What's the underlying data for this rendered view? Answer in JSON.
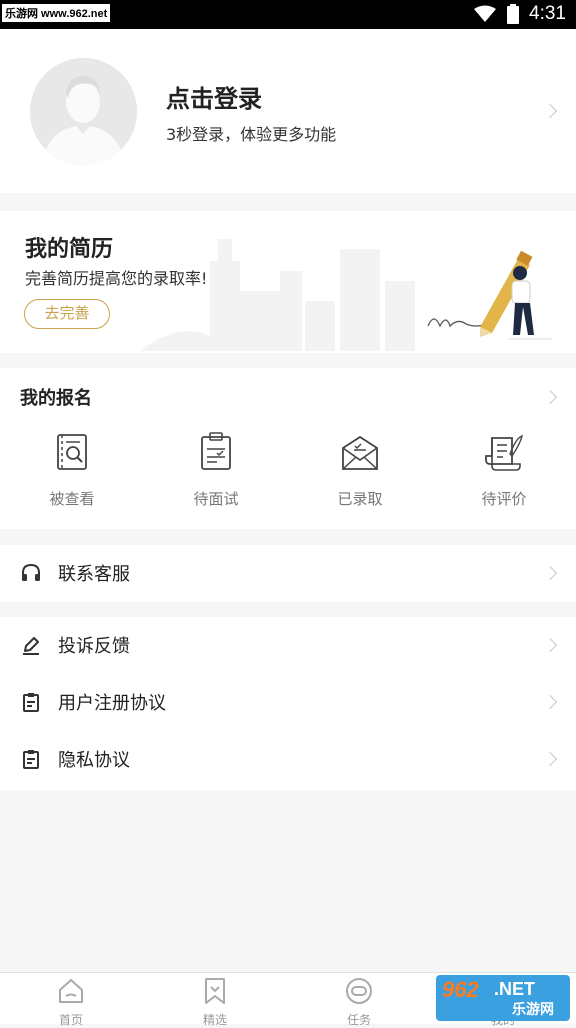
{
  "status_bar": {
    "watermark": "乐游网 www.962.net",
    "time": "4:31"
  },
  "login": {
    "title": "点击登录",
    "subtitle": "3秒登录，体验更多功能"
  },
  "resume": {
    "title": "我的简历",
    "subtitle": "完善简历提高您的录取率!",
    "button": "去完善"
  },
  "signup": {
    "title": "我的报名",
    "items": [
      {
        "label": "被查看",
        "icon": "viewed-icon"
      },
      {
        "label": "待面试",
        "icon": "clipboard-interview-icon"
      },
      {
        "label": "已录取",
        "icon": "envelope-accepted-icon"
      },
      {
        "label": "待评价",
        "icon": "scroll-review-icon"
      }
    ]
  },
  "service": {
    "label": "联系客服",
    "icon": "headset-icon"
  },
  "menu": [
    {
      "label": "投诉反馈",
      "icon": "edit-icon"
    },
    {
      "label": "用户注册协议",
      "icon": "document-icon"
    },
    {
      "label": "隐私协议",
      "icon": "document-icon"
    }
  ],
  "tabbar": [
    {
      "label": "首页",
      "icon": "home-icon"
    },
    {
      "label": "精选",
      "icon": "bookmark-icon"
    },
    {
      "label": "任务",
      "icon": "task-icon"
    },
    {
      "label": "我的",
      "icon": "profile-icon"
    }
  ],
  "bottom_watermark": {
    "brand": "962",
    "net": ".NET",
    "cn": "乐游网"
  },
  "colors": {
    "accent": "#c9a24c",
    "text": "#222222",
    "muted": "#777777",
    "background": "#f6f6f6"
  }
}
